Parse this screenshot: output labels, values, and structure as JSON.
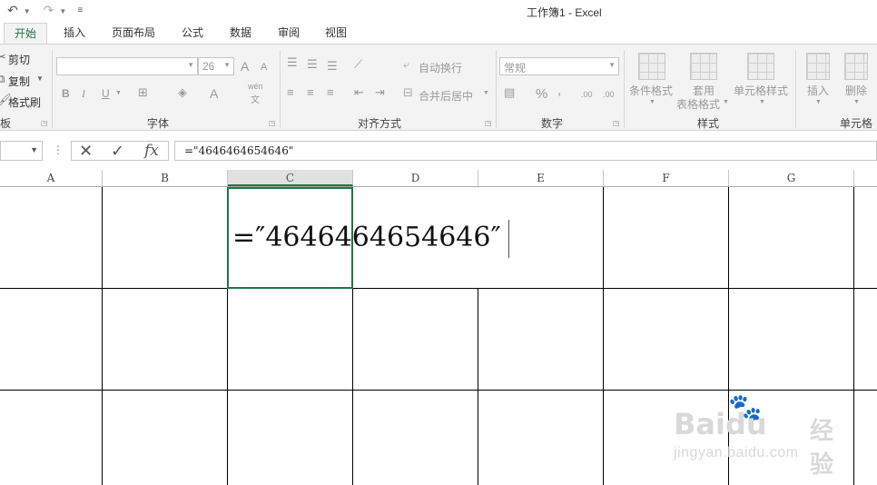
{
  "window": {
    "title": "工作簿1 - Excel"
  },
  "qat": {
    "undo": "↶",
    "redo": "↷",
    "customize": "⚌"
  },
  "tabs": [
    "开始",
    "插入",
    "页面布局",
    "公式",
    "数据",
    "审阅",
    "视图"
  ],
  "ribbon": {
    "clipboard": {
      "cut": "剪切",
      "copy": "复制",
      "painter": "格式刷",
      "label": "板"
    },
    "font": {
      "name_value": "",
      "size_value": "26",
      "grow": "A",
      "shrink": "A",
      "bold": "B",
      "italic": "I",
      "underline": "U",
      "phonetic_top": "wén",
      "phonetic_bottom": "文",
      "label": "字体"
    },
    "alignment": {
      "wrap_text": "自动换行",
      "merge_center": "合并后居中",
      "label": "对齐方式"
    },
    "number": {
      "format_value": "常规",
      "percent": "%",
      "comma": ",",
      "inc_decimal": ".00",
      "dec_decimal": ".00",
      "label": "数字"
    },
    "styles": {
      "conditional": "条件格式",
      "table_format_1": "套用",
      "table_format_2": "表格格式",
      "cell_styles": "单元格样式",
      "label": "样式"
    },
    "cells": {
      "insert": "插入",
      "delete": "删除",
      "label": "单元格"
    }
  },
  "formula_bar": {
    "cancel": "✕",
    "enter": "✓",
    "fx": "fx",
    "value": "=\"4646464654646\""
  },
  "columns": [
    "A",
    "B",
    "C",
    "D",
    "E",
    "F",
    "G"
  ],
  "selected_column": "C",
  "active_cell": {
    "display": "=″4646464654646″"
  },
  "watermark": {
    "brand": "Baidu",
    "cn": "经验",
    "url": "jingyan.baidu.com"
  }
}
